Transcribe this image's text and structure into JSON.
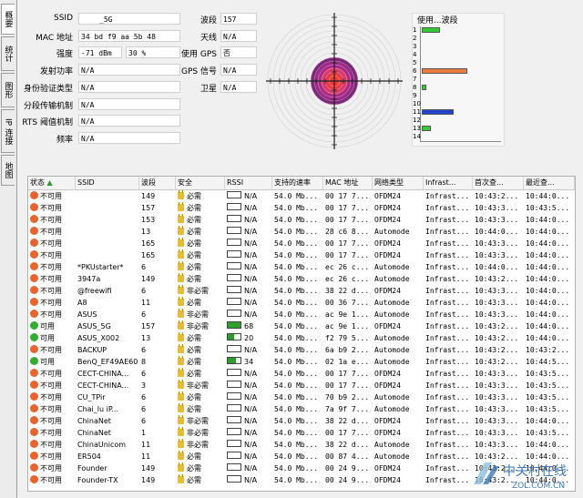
{
  "tabs": [
    "概要",
    "统计",
    "图形",
    "IP 连接",
    "地图"
  ],
  "info": {
    "left": [
      {
        "label": "SSID",
        "value": "_5G"
      },
      {
        "label": "MAC 地址",
        "value": "34 bd f9 aa 5b 48"
      },
      {
        "label": "强度",
        "value": "-71 dBm",
        "value2": "30 %"
      },
      {
        "label": "发射功率",
        "value": "N/A"
      },
      {
        "label": "身份验证类型",
        "value": "N/A"
      },
      {
        "label": "分段传输机制",
        "value": "N/A"
      },
      {
        "label": "RTS 阈值机制",
        "value": "N/A"
      },
      {
        "label": "频率",
        "value": "N/A"
      }
    ],
    "right": [
      {
        "label": "波段",
        "value": "157"
      },
      {
        "label": "天线",
        "value": "N/A"
      },
      {
        "label": "使用 GPS",
        "value": "否"
      },
      {
        "label": "GPS 信号",
        "value": "N/A"
      },
      {
        "label": "卫星",
        "value": "N/A"
      }
    ]
  },
  "channel_usage": {
    "title": "使用...波段",
    "channels": [
      "1",
      "2",
      "3",
      "4",
      "5",
      "6",
      "7",
      "8",
      "9",
      "10",
      "11",
      "12",
      "13",
      "14"
    ],
    "levels": [
      4,
      0,
      0,
      0,
      0,
      10,
      0,
      1,
      0,
      0,
      7,
      0,
      2,
      0
    ],
    "colors": {
      "1": "#33cc33",
      "6": "#e87d3e",
      "8": "#33cc33",
      "11": "#2244cc",
      "13": "#33cc33"
    }
  },
  "table": {
    "headers": [
      "状态",
      "SSID",
      "波段",
      "安全",
      "RSSI",
      "支持的速率",
      "MAC 地址",
      "网络类型",
      "Infrast...",
      "首次查...",
      "最近查..."
    ],
    "rows": [
      [
        "不可用",
        "",
        "149",
        "必需",
        "N/A",
        "54.0 Mb...",
        "00 17 7...",
        "OFDM24",
        "Infrast...",
        "10:43:2...",
        "10:44:0..."
      ],
      [
        "不可用",
        "",
        "157",
        "必需",
        "N/A",
        "54.0 Mb...",
        "00 17 7...",
        "OFDM24",
        "Infrast...",
        "10:43:3...",
        "10:43:5..."
      ],
      [
        "不可用",
        "",
        "153",
        "必需",
        "N/A",
        "54.0 Mb...",
        "00 17 7...",
        "OFDM24",
        "Infrast...",
        "10:43:3...",
        "10:44:0..."
      ],
      [
        "不可用",
        "",
        "13",
        "必需",
        "N/A",
        "54.0 Mb...",
        "28 c6 8...",
        "Automode",
        "Infrast...",
        "10:44:0...",
        "10:44:0..."
      ],
      [
        "不可用",
        "",
        "165",
        "必需",
        "N/A",
        "54.0 Mb...",
        "00 17 7...",
        "OFDM24",
        "Infrast...",
        "10:43:3...",
        "10:44:0..."
      ],
      [
        "不可用",
        "",
        "165",
        "必需",
        "N/A",
        "54.0 Mb...",
        "00 17 7...",
        "OFDM24",
        "Infrast...",
        "10:43:3...",
        "10:44:0..."
      ],
      [
        "不可用",
        "*PKUstarter*",
        "6",
        "必需",
        "N/A",
        "54.0 Mb...",
        "ec 26 c...",
        "Automode",
        "Infrast...",
        "10:44:0...",
        "10:44:0..."
      ],
      [
        "不可用",
        "3947a",
        "149",
        "必需",
        "N/A",
        "54.0 Mb...",
        "ec 26 c...",
        "Automode",
        "Infrast...",
        "10:43:2...",
        "10:44:0..."
      ],
      [
        "不可用",
        "@freewifi",
        "6",
        "非必需",
        "N/A",
        "54.0 Mb...",
        "38 22 d...",
        "OFDM24",
        "Infrast...",
        "10:43:3...",
        "10:44:0..."
      ],
      [
        "不可用",
        "A8",
        "11",
        "必需",
        "N/A",
        "54.0 Mb...",
        "00 36 7...",
        "Automode",
        "Infrast...",
        "10:43:3...",
        "10:44:0..."
      ],
      [
        "不可用",
        "ASUS",
        "6",
        "非必需",
        "N/A",
        "54.0 Mb...",
        "ac 9e 1...",
        "Automode",
        "Infrast...",
        "10:43:3...",
        "10:44:0..."
      ],
      [
        "可用",
        "ASUS_5G",
        "157",
        "非必需",
        "68",
        "54.0 Mb...",
        "ac 9e 1...",
        "OFDM24",
        "Infrast...",
        "10:43:2...",
        "10:44:0..."
      ],
      [
        "可用",
        "ASUS_X002",
        "13",
        "必需",
        "20",
        "54.0 Mb...",
        "f2 79 5...",
        "Automode",
        "Infrast...",
        "10:43:2...",
        "10:44:0..."
      ],
      [
        "不可用",
        "BACKUP",
        "6",
        "必需",
        "N/A",
        "54.0 Mb...",
        "6a b9 2...",
        "Automode",
        "Infrast...",
        "10:43:2...",
        "10:43:2..."
      ],
      [
        "可用",
        "BenQ_EF49AE60",
        "8",
        "必需",
        "34",
        "54.0 Mb...",
        "02 1a e...",
        "Automode",
        "Infrast...",
        "10:43:2...",
        "10:44:5..."
      ],
      [
        "不可用",
        "CECT-CHINA...",
        "6",
        "必需",
        "N/A",
        "54.0 Mb...",
        "00 17 7...",
        "OFDM24",
        "Infrast...",
        "10:43:3...",
        "10:43:5..."
      ],
      [
        "不可用",
        "CECT-CHINA...",
        "3",
        "非必需",
        "N/A",
        "54.0 Mb...",
        "00 17 7...",
        "OFDM24",
        "Infrast...",
        "10:43:3...",
        "10:43:5..."
      ],
      [
        "不可用",
        "CU_TPir",
        "6",
        "必需",
        "N/A",
        "54.0 Mb...",
        "70 b9 2...",
        "Automode",
        "Infrast...",
        "10:43:3...",
        "10:43:5..."
      ],
      [
        "不可用",
        "Chai_lu iP...",
        "6",
        "必需",
        "N/A",
        "54.0 Mb...",
        "7a 9f 7...",
        "Automode",
        "Infrast...",
        "10:43:3...",
        "10:43:5..."
      ],
      [
        "不可用",
        "ChinaNet",
        "6",
        "非必需",
        "N/A",
        "54.0 Mb...",
        "38 22 d...",
        "OFDM24",
        "Infrast...",
        "10:43:3...",
        "10:44:0..."
      ],
      [
        "不可用",
        "ChinaNet",
        "1",
        "非必需",
        "N/A",
        "54.0 Mb...",
        "00 17 7...",
        "OFDM24",
        "Infrast...",
        "10:43:3...",
        "10:43:5..."
      ],
      [
        "不可用",
        "ChinaUnicom",
        "11",
        "非必需",
        "N/A",
        "54.0 Mb...",
        "38 22 d...",
        "Automode",
        "Infrast...",
        "10:43:3...",
        "10:44:0..."
      ],
      [
        "不可用",
        "ER504",
        "11",
        "必需",
        "N/A",
        "54.0 Mb...",
        "00 87 4...",
        "Automode",
        "Infrast...",
        "10:43:2...",
        "10:44:0..."
      ],
      [
        "不可用",
        "Founder",
        "149",
        "必需",
        "N/A",
        "54.0 Mb...",
        "00 24 9...",
        "OFDM24",
        "Infrast...",
        "10:43:2...",
        "10:44:0..."
      ],
      [
        "不可用",
        "Founder-TX",
        "149",
        "必需",
        "N/A",
        "54.0 Mb...",
        "00 24 9...",
        "OFDM24",
        "Infrast...",
        "10:43:2...",
        "10:44:0..."
      ]
    ]
  },
  "watermark": {
    "cn": "中关村在线",
    "en": "ZOL.COM.CN"
  },
  "colors": {
    "available": "#2fae2f",
    "unavailable": "#e8642c",
    "lock": "#e8c020"
  }
}
